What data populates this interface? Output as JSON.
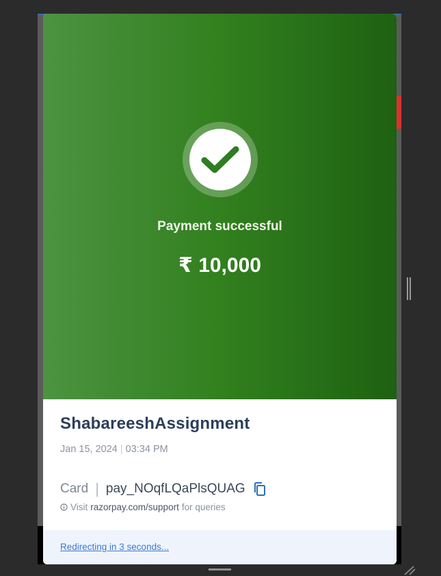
{
  "payment": {
    "status_title": "Payment successful",
    "amount": "₹ 10,000",
    "check_icon": "check-circle-icon",
    "accent_color": "#32801e"
  },
  "details": {
    "merchant_name": "ShabareeshAssignment",
    "date": "Jan 15, 2024",
    "date_time_separator": "|",
    "time": "03:34 PM",
    "method": "Card",
    "method_separator": "|",
    "payment_id": "pay_NOqfLQaPlsQUAG",
    "copy_icon": "copy-icon"
  },
  "support": {
    "prefix": "Visit",
    "link": "razorpay.com/support",
    "suffix": "for queries",
    "icon": "info-icon"
  },
  "footer": {
    "redirect_text": "Redirecting in 3 seconds..."
  }
}
